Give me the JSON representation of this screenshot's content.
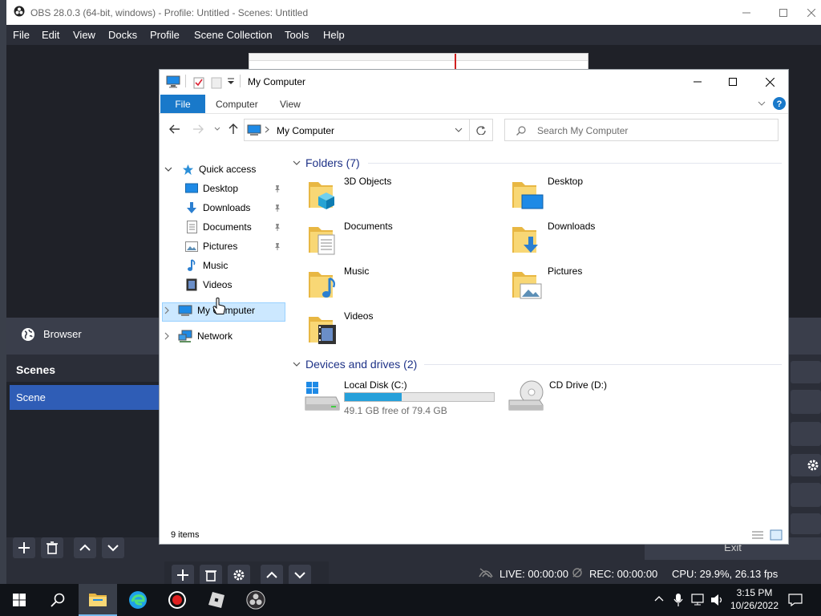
{
  "obs": {
    "window_title": "OBS 28.0.3 (64-bit, windows) - Profile: Untitled - Scenes: Untitled",
    "menu": [
      "File",
      "Edit",
      "View",
      "Docks",
      "Profile",
      "Scene Collection",
      "Tools",
      "Help"
    ],
    "source_label": "Browser",
    "scenes_header": "Scenes",
    "scene_item": "Scene",
    "exit_label": "Exit",
    "status": {
      "live": "LIVE: 00:00:00",
      "rec": "REC: 00:00:00",
      "cpu": "CPU: 29.9%, 26.13 fps"
    }
  },
  "explorer": {
    "title": "My Computer",
    "ribbon_tabs": [
      "File",
      "Computer",
      "View"
    ],
    "address": "My Computer",
    "search_placeholder": "Search My Computer",
    "nav": {
      "quick_access": "Quick access",
      "items": [
        "Desktop",
        "Downloads",
        "Documents",
        "Pictures",
        "Music",
        "Videos"
      ],
      "my_computer": "My Computer",
      "network": "Network"
    },
    "folders_header": "Folders (7)",
    "folders": [
      "3D Objects",
      "Desktop",
      "Documents",
      "Downloads",
      "Music",
      "Pictures",
      "Videos"
    ],
    "drives_header": "Devices and drives (2)",
    "drives": [
      {
        "name": "Local Disk (C:)",
        "free": "49.1 GB free of 79.4 GB",
        "used_fraction": 0.38
      },
      {
        "name": "CD Drive (D:)"
      }
    ],
    "status_items": "9 items"
  },
  "taskbar": {
    "time": "3:15 PM",
    "date": "10/26/2022"
  },
  "colors": {
    "accent": "#1979ca",
    "obs_bg": "#2b2e38",
    "scene_selected": "#2f5db6",
    "folder_yellow": "#f8d775"
  }
}
